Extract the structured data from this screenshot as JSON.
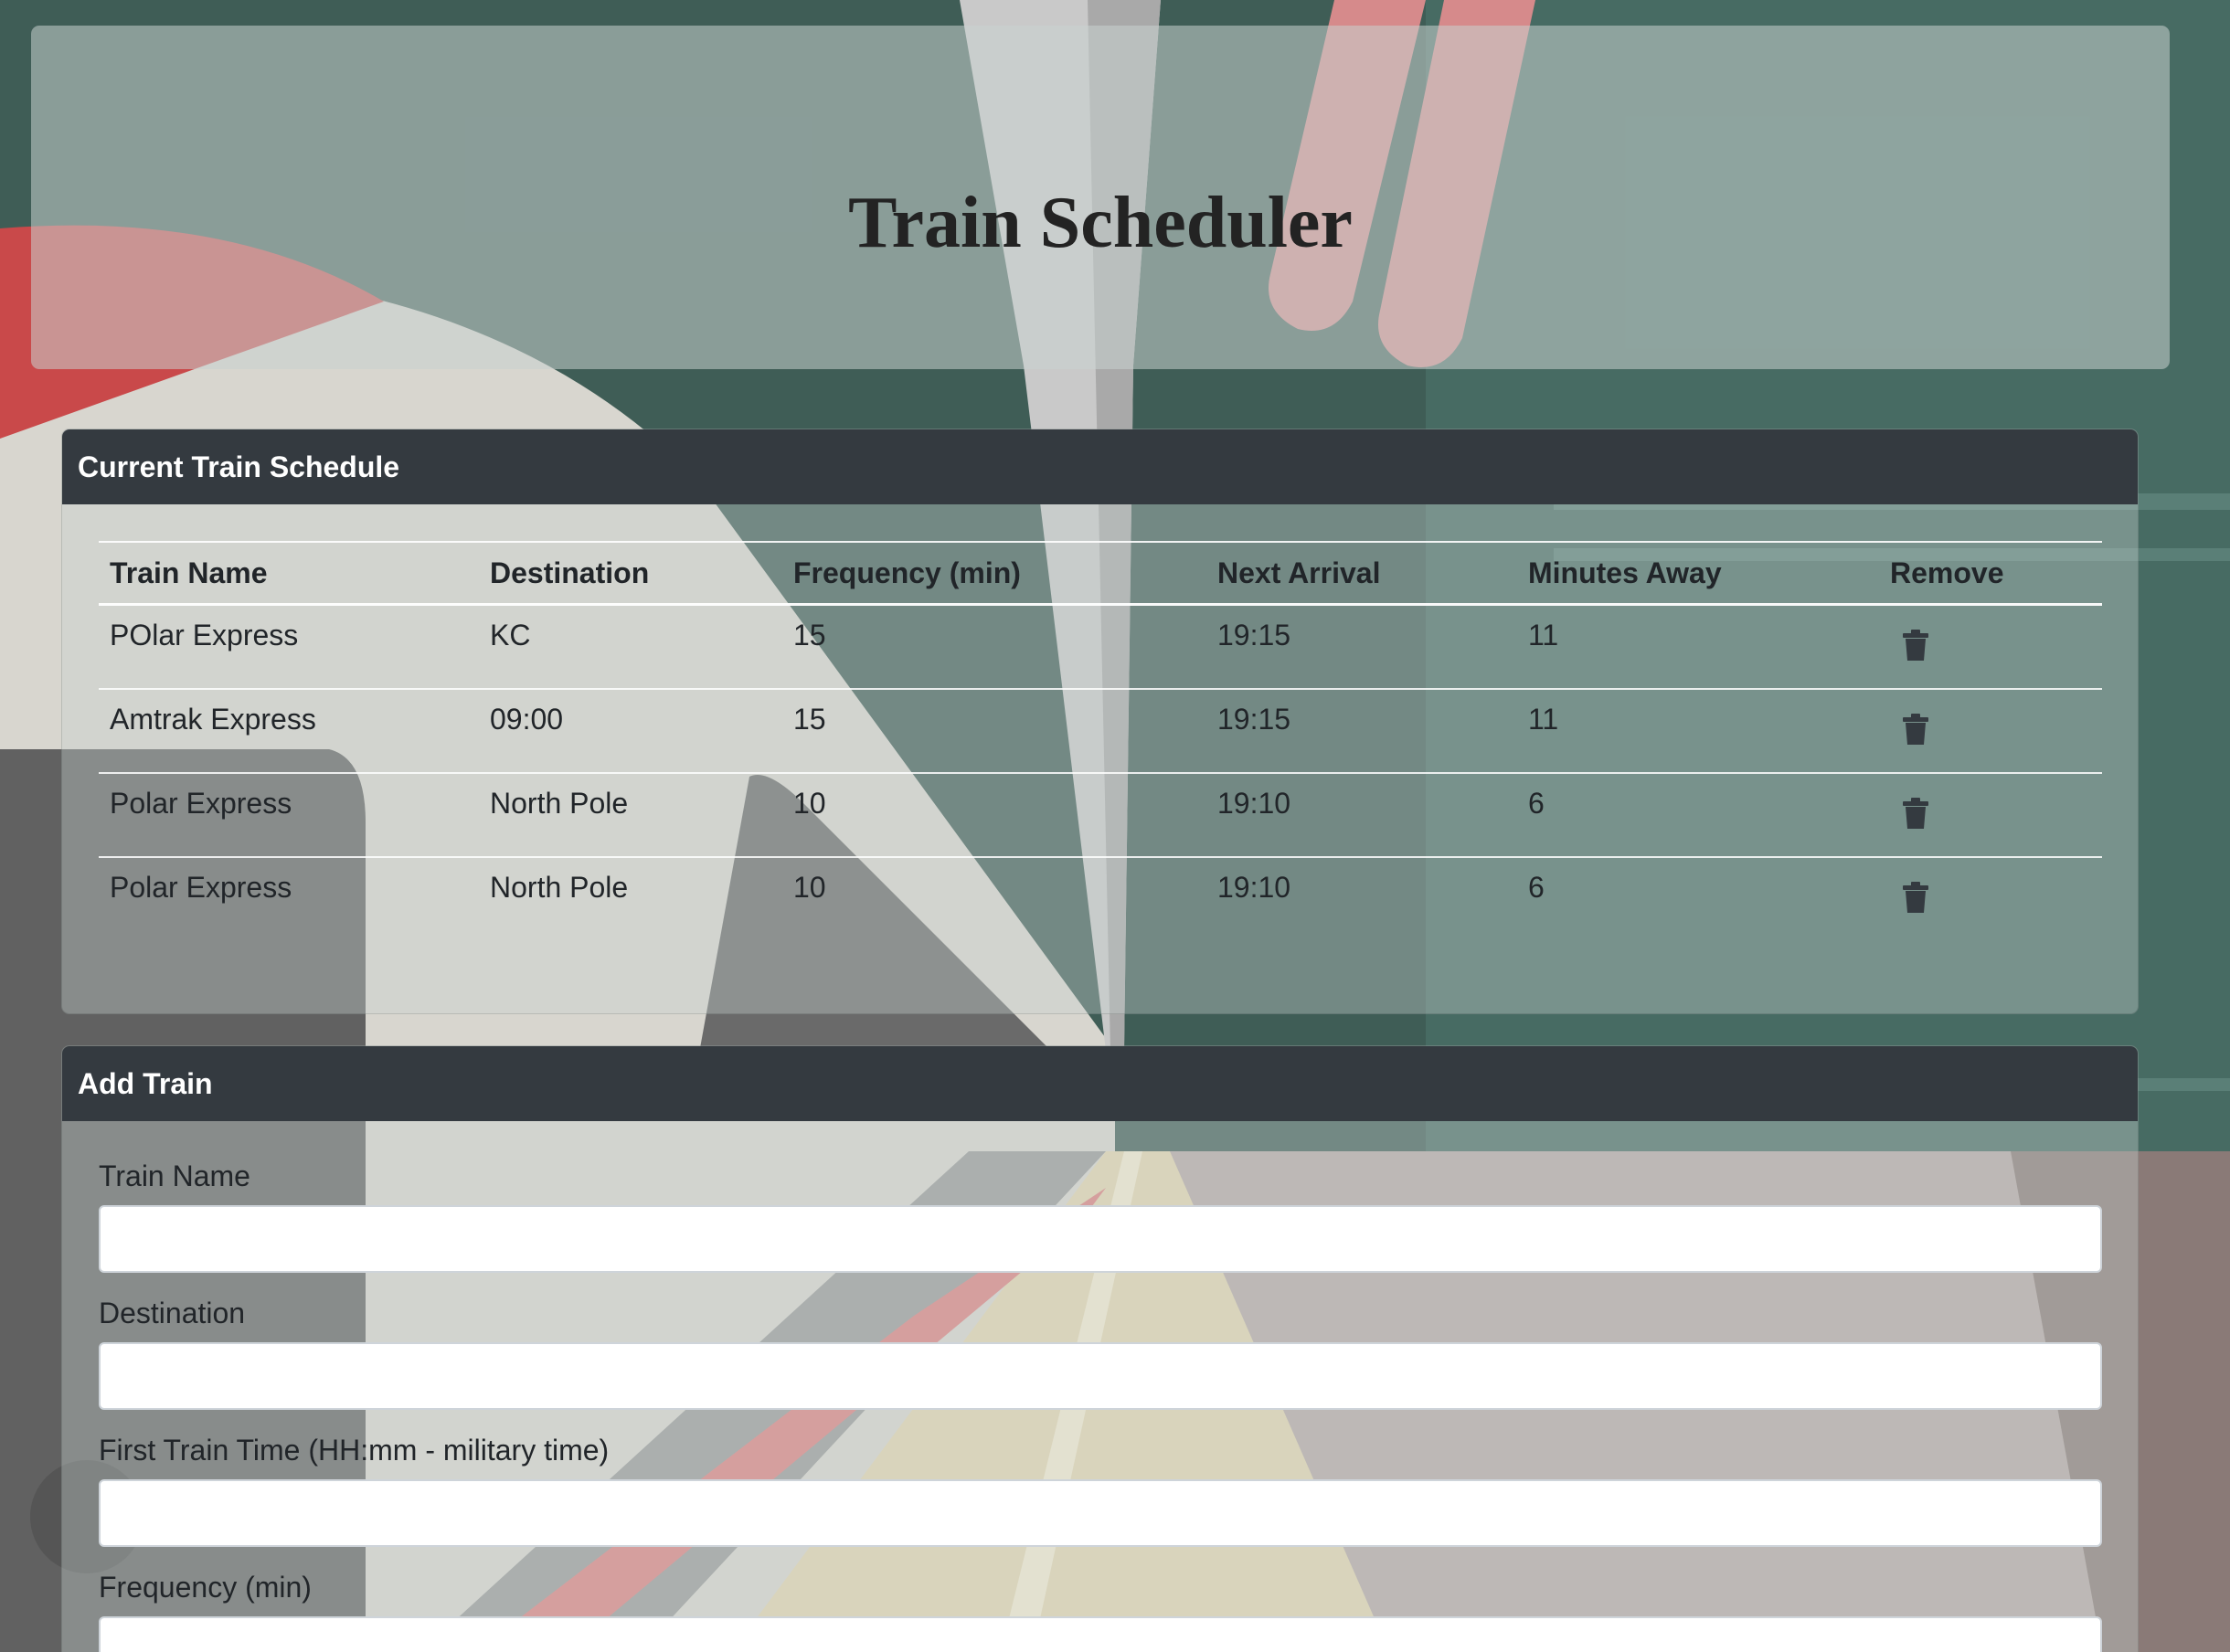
{
  "header": {
    "title": "Train Scheduler"
  },
  "schedule": {
    "card_title": "Current Train Schedule",
    "columns": [
      "Train Name",
      "Destination",
      "Frequency (min)",
      "Next Arrival",
      "Minutes Away",
      "Remove"
    ],
    "rows": [
      {
        "name": "POlar Express",
        "destination": "KC",
        "frequency": "15",
        "next_arrival": "19:15",
        "minutes_away": "11",
        "remove_icon": "trash-icon"
      },
      {
        "name": "Amtrak Express",
        "destination": "09:00",
        "frequency": "15",
        "next_arrival": "19:15",
        "minutes_away": "11",
        "remove_icon": "trash-icon"
      },
      {
        "name": "Polar Express",
        "destination": "North Pole",
        "frequency": "10",
        "next_arrival": "19:10",
        "minutes_away": "6",
        "remove_icon": "trash-icon"
      },
      {
        "name": "Polar Express",
        "destination": "North Pole",
        "frequency": "10",
        "next_arrival": "19:10",
        "minutes_away": "6",
        "remove_icon": "trash-icon"
      }
    ]
  },
  "add_train": {
    "card_title": "Add Train",
    "fields": [
      {
        "label": "Train Name",
        "value": ""
      },
      {
        "label": "Destination",
        "value": ""
      },
      {
        "label": "First Train Time (HH:mm - military time)",
        "value": ""
      },
      {
        "label": "Frequency (min)",
        "value": ""
      }
    ]
  },
  "colors": {
    "card_header": "#343a40",
    "title_text": "#232323"
  }
}
